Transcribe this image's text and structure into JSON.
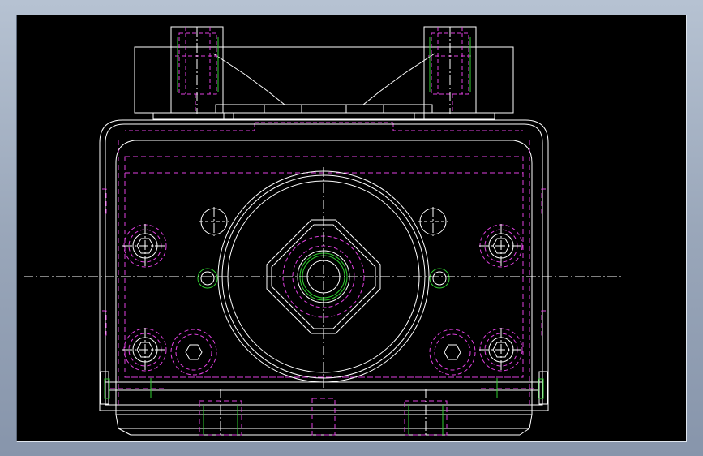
{
  "viewport": {
    "background": "#000000",
    "colors": {
      "outline": "#ffffff",
      "hidden": "#e040e0",
      "accent": "#30d030"
    }
  }
}
